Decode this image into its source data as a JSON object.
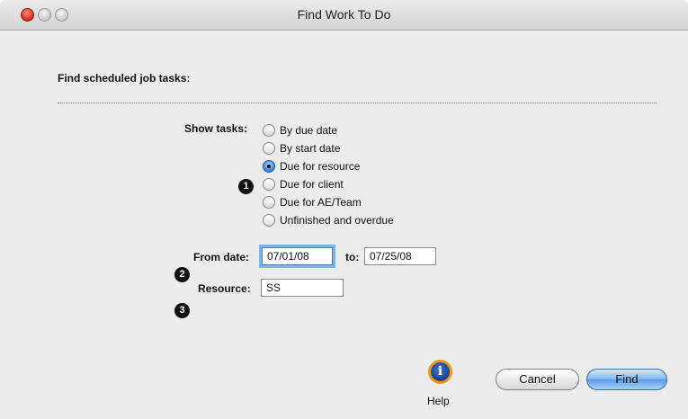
{
  "window": {
    "title": "Find Work To Do"
  },
  "heading": "Find scheduled job tasks:",
  "show_tasks": {
    "label": "Show tasks:",
    "options": [
      {
        "label": "By due date",
        "selected": false
      },
      {
        "label": "By start date",
        "selected": false
      },
      {
        "label": "Due for resource",
        "selected": true
      },
      {
        "label": "Due for client",
        "selected": false
      },
      {
        "label": "Due for AE/Team",
        "selected": false
      },
      {
        "label": "Unfinished and overdue",
        "selected": false
      }
    ]
  },
  "callouts": [
    "1",
    "2",
    "3"
  ],
  "dates": {
    "from_label": "From date:",
    "from_value": "07/01/08",
    "to_label": "to:",
    "to_value": "07/25/08"
  },
  "resource": {
    "label": "Resource:",
    "value": "SS"
  },
  "buttons": {
    "help_label": "Help",
    "help_icon": "info-icon",
    "cancel_label": "Cancel",
    "find_label": "Find"
  }
}
